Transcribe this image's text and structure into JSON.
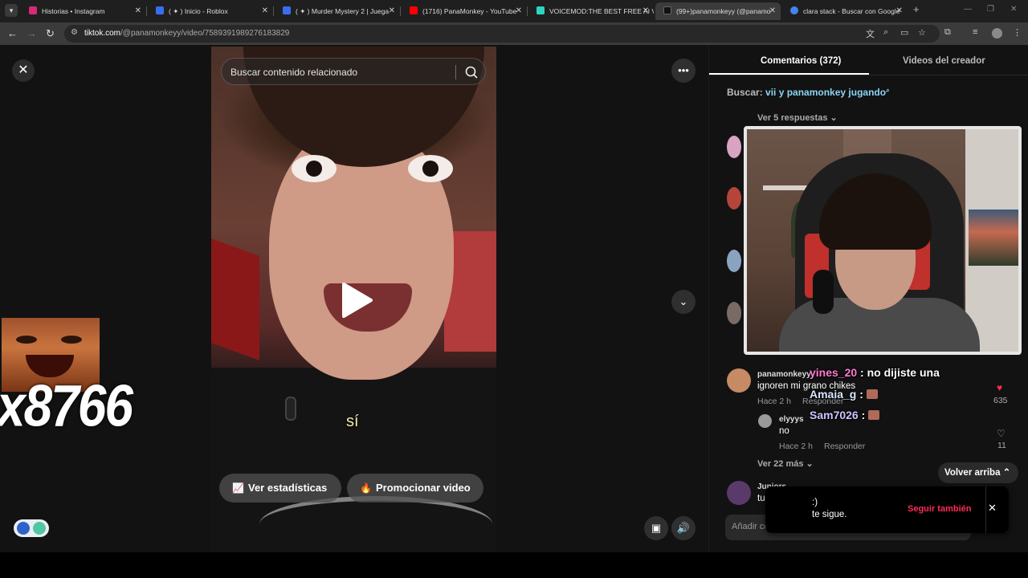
{
  "browser": {
    "tabs": [
      {
        "title": "Historias • Instagram",
        "color": "#d62976"
      },
      {
        "title": "( ✦ ) Inicio - Roblox",
        "color": "#3a6df0"
      },
      {
        "title": "( ✦ ) Murder Mystery 2 | Juega",
        "color": "#3a6df0"
      },
      {
        "title": "(1716) PanaMonkey - YouTube",
        "color": "#ff0000"
      },
      {
        "title": "VOICEMOD:THE BEST FREE AI V",
        "color": "#2dd4bf"
      },
      {
        "title": "(99+)panamonkeyy (@panamo",
        "color": "#111111"
      },
      {
        "title": "clara stack - Buscar con Google",
        "color": "#4285f4"
      }
    ],
    "url_host": "tiktok.com",
    "url_path": "/@panamonkeyy/video/7589391989276183829"
  },
  "video": {
    "search_placeholder": "Buscar contenido relacionado",
    "caption": "sí",
    "stats_button": "Ver estadísticas",
    "promote_button": "Promocionar video"
  },
  "overlay": {
    "counter_text": "x8766"
  },
  "comments": {
    "tab_comments": "Comentarios (372)",
    "tab_creator": "Videos del creador",
    "search_label": "Buscar:",
    "search_keyword": "vii y panamonkey jugando",
    "view_replies": "Ver 5 respuestas",
    "comment_user": "panamonkeyy",
    "comment_text": "ignoren mi grano chikes",
    "comment_time": "Hace 2 h",
    "comment_reply": "Responder",
    "comment_likes": "635",
    "reply_user": "elyyys",
    "reply_text": "no",
    "reply_time": "Hace 2 h",
    "reply_reply": "Responder",
    "reply_likes": "11",
    "view_more": "Ver 22 más",
    "next_user": "Juniors",
    "next_text": "tu",
    "back_to_top": "Volver arriba",
    "add_comment_placeholder": "Añadir comentario..."
  },
  "stream_chat": [
    {
      "name": "yines_20",
      "msg": "no dijiste una"
    },
    {
      "name": "Amaia_g",
      "msg": ""
    },
    {
      "name": "Sam7026",
      "msg": ""
    }
  ],
  "toast": {
    "line1": ":)",
    "line2": "te sigue.",
    "follow_back": "Seguir también"
  }
}
